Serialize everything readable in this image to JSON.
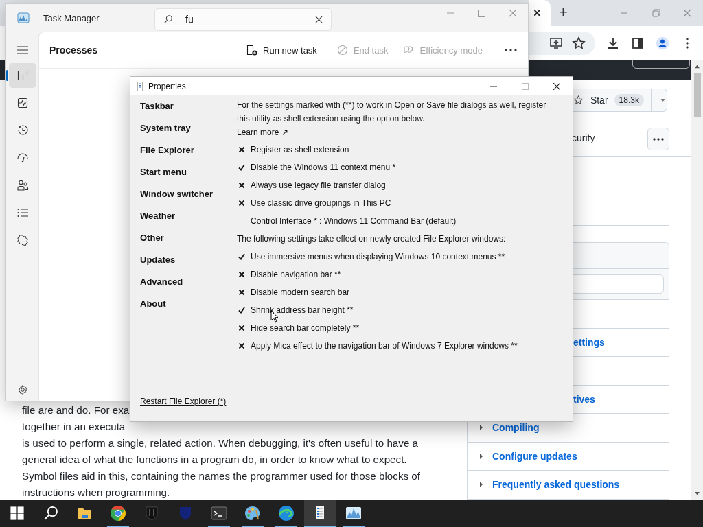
{
  "browser": {
    "tab_close": "×",
    "new_tab": "+",
    "star_button": {
      "label": "Star",
      "count": "18.3k"
    },
    "repo_nav_item": "curity",
    "sidebar_rows": [
      {
        "kind": "cut",
        "label": "ettings"
      },
      {
        "kind": "cut",
        "label": "tives"
      },
      {
        "kind": "link",
        "label": "Compiling"
      },
      {
        "kind": "link",
        "label": "Configure updates"
      },
      {
        "kind": "link",
        "label": "Frequently asked questions"
      }
    ],
    "article_lines": [
      "file are and do. For exa",
      "together in an executa",
      "is used to perform a single, related action. When debugging, it's often useful to have a",
      "general idea of what the functions in a program do, in order to know what to expect.",
      "Symbol files aid in this, containing the names the programmer used for those blocks of",
      "instructions when programming."
    ]
  },
  "task_manager": {
    "title": "Task Manager",
    "search": {
      "value": "fu"
    },
    "page_title": "Processes",
    "toolbar": [
      {
        "label": "Run new task",
        "disabled": false
      },
      {
        "label": "End task",
        "disabled": true
      },
      {
        "label": "Efficiency mode",
        "disabled": true
      }
    ],
    "nav": [
      {
        "selected": true
      },
      {
        "selected": false
      },
      {
        "selected": false
      },
      {
        "selected": false
      },
      {
        "selected": false
      },
      {
        "selected": false
      },
      {
        "selected": false
      }
    ]
  },
  "properties": {
    "title": "Properties",
    "sidebar": [
      {
        "label": "Taskbar",
        "selected": false
      },
      {
        "label": "System tray",
        "selected": false
      },
      {
        "label": "File Explorer",
        "selected": true
      },
      {
        "label": "Start menu",
        "selected": false
      },
      {
        "label": "Window switcher",
        "selected": false
      },
      {
        "label": "Weather",
        "selected": false
      },
      {
        "label": "Other",
        "selected": false
      },
      {
        "label": "Updates",
        "selected": false
      },
      {
        "label": "Advanced",
        "selected": false
      },
      {
        "label": "About",
        "selected": false
      }
    ],
    "intro": "For the settings marked with (**) to work in Open or Save file dialogs as well, register this utility as shell extension using the option below.",
    "learn_more": "Learn more ↗",
    "options": [
      {
        "kind": "toggle",
        "label": "Register as shell extension",
        "checked": false
      },
      {
        "kind": "toggle",
        "label": "Disable the Windows 11 context menu *",
        "checked": true
      },
      {
        "kind": "toggle",
        "label": "Always use legacy file transfer dialog",
        "checked": false
      },
      {
        "kind": "toggle",
        "label": "Use classic drive groupings in This PC",
        "checked": false
      },
      {
        "kind": "choice",
        "label": "Control Interface * : Windows 11 Command Bar (default)"
      },
      {
        "kind": "heading",
        "label": "The following settings take effect on newly created File Explorer windows:"
      },
      {
        "kind": "toggle",
        "label": "Use immersive menus when displaying Windows 10 context menus **",
        "checked": true
      },
      {
        "kind": "toggle",
        "label": "Disable navigation bar **",
        "checked": false
      },
      {
        "kind": "toggle",
        "label": "Disable modern search bar",
        "checked": false
      },
      {
        "kind": "toggle",
        "label": "Shrink address bar height **",
        "checked": true
      },
      {
        "kind": "toggle",
        "label": "Hide search bar completely **",
        "checked": false
      },
      {
        "kind": "toggle",
        "label": "Apply Mica effect to the navigation bar of Windows 7 Explorer windows **",
        "checked": false
      }
    ],
    "restart_link": "Restart File Explorer (*)"
  },
  "taskbar": {
    "apps": [
      {
        "running": false,
        "selected": false
      },
      {
        "running": true,
        "selected": false
      },
      {
        "running": false,
        "selected": false
      },
      {
        "running": false,
        "selected": false
      },
      {
        "running": true,
        "selected": false
      },
      {
        "running": true,
        "selected": false
      },
      {
        "running": true,
        "selected": false
      },
      {
        "running": true,
        "selected": true
      },
      {
        "running": true,
        "selected": false
      }
    ]
  }
}
